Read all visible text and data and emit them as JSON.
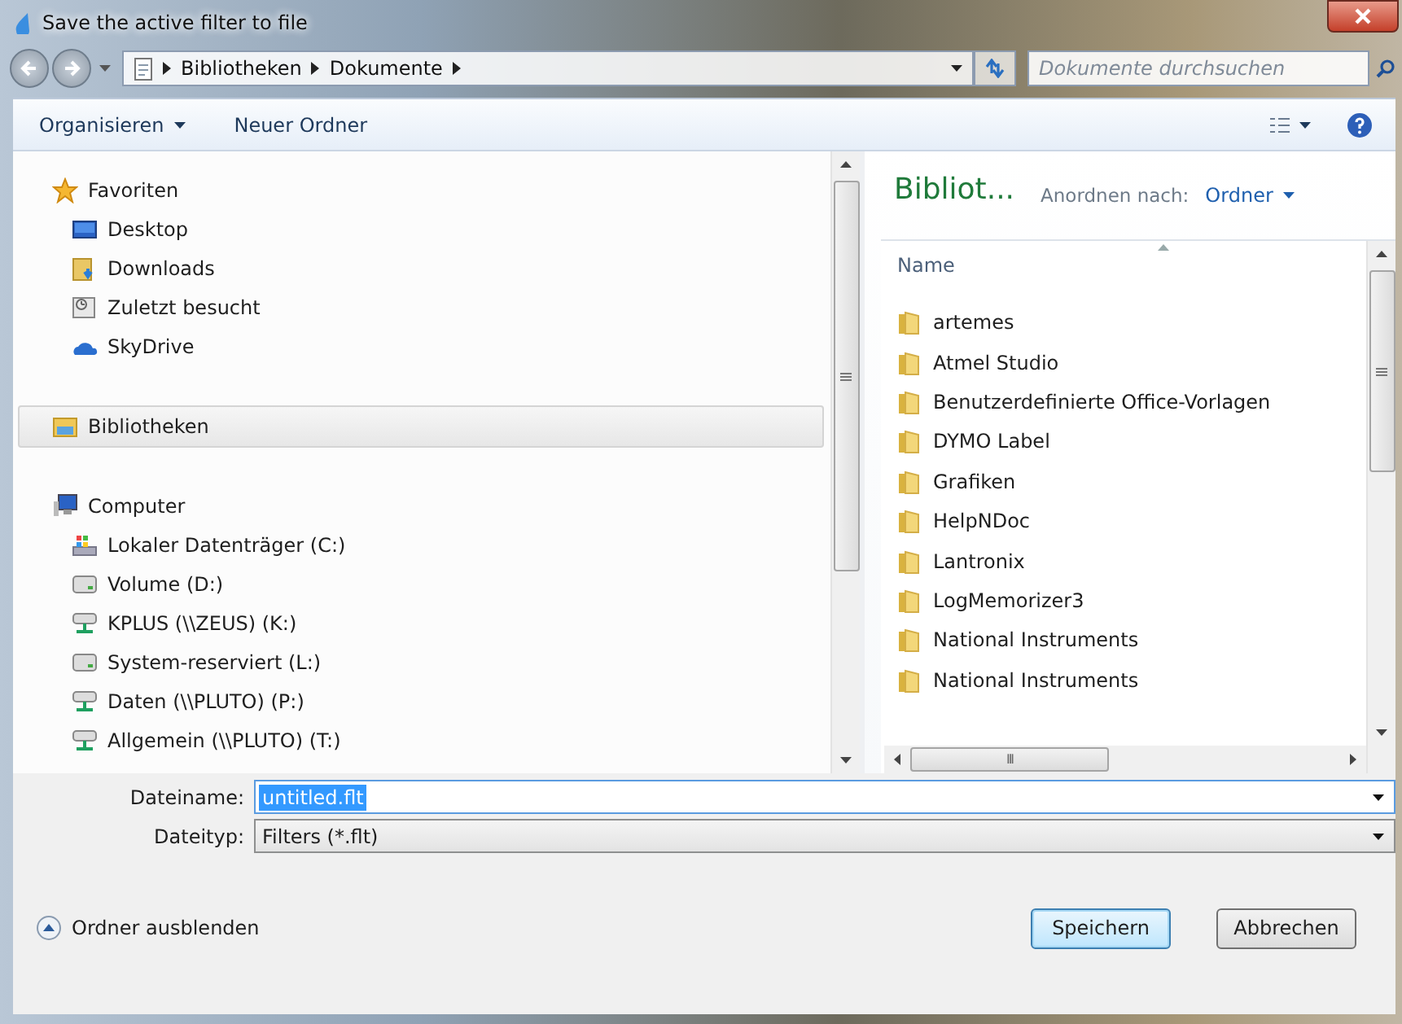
{
  "window": {
    "title": "Save the active filter to file"
  },
  "address_bar": {
    "crumbs": [
      "Bibliotheken",
      "Dokumente"
    ]
  },
  "search": {
    "placeholder": "Dokumente durchsuchen"
  },
  "toolbar": {
    "organize": "Organisieren",
    "new_folder": "Neuer Ordner"
  },
  "nav_tree": [
    {
      "label": "Favoriten",
      "kind": "star",
      "selected": false,
      "children": [
        {
          "label": "Desktop",
          "kind": "desktop",
          "selected": false
        },
        {
          "label": "Downloads",
          "kind": "downloads",
          "selected": false
        },
        {
          "label": "Zuletzt besucht",
          "kind": "recent",
          "selected": false
        },
        {
          "label": "SkyDrive",
          "kind": "cloud",
          "selected": false
        }
      ]
    },
    {
      "label": "Bibliotheken",
      "kind": "library",
      "selected": true
    },
    {
      "label": "Computer",
      "kind": "computer",
      "selected": false,
      "children": [
        {
          "label": "Lokaler Datenträger (C:)",
          "kind": "system-drive",
          "selected": false
        },
        {
          "label": "Volume (D:)",
          "kind": "drive",
          "selected": false
        },
        {
          "label": "KPLUS (\\\\ZEUS) (K:)",
          "kind": "network-drive",
          "selected": false
        },
        {
          "label": "System-reserviert (L:)",
          "kind": "drive",
          "selected": false
        },
        {
          "label": "Daten (\\\\PLUTO) (P:)",
          "kind": "network-drive",
          "selected": false
        },
        {
          "label": "Allgemein (\\\\PLUTO) (T:)",
          "kind": "network-drive",
          "selected": false
        }
      ]
    }
  ],
  "library": {
    "title": "Bibliot...",
    "arrange_label": "Anordnen nach:",
    "arrange_value": "Ordner"
  },
  "file_list": {
    "columns": [
      "Name"
    ],
    "rows": [
      "artemes",
      "Atmel Studio",
      "Benutzerdefinierte Office-Vorlagen",
      "DYMO Label",
      "Grafiken",
      "HelpNDoc",
      "Lantronix",
      "LogMemorizer3",
      "National Instruments",
      "National Instruments"
    ]
  },
  "scrollbar_glyph": "III",
  "filename": {
    "label": "Dateiname:",
    "value": "untitled.flt",
    "text_selected": true
  },
  "filetype": {
    "label": "Dateityp:",
    "value": "Filters (*.flt)"
  },
  "hide_folders": "Ordner ausblenden",
  "buttons": [
    "Speichern",
    "Abbrechen"
  ]
}
